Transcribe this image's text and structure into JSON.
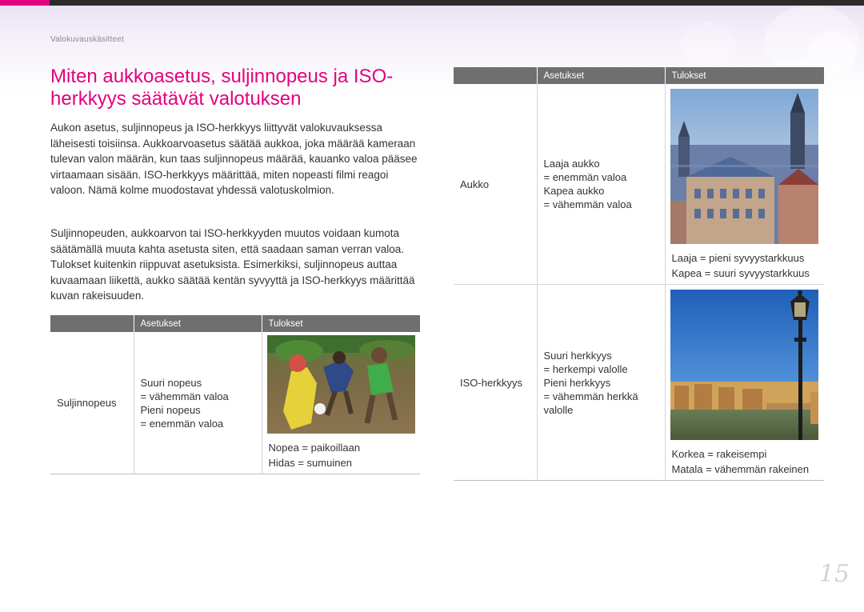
{
  "header": {
    "section_label": "Valokuvauskäsitteet"
  },
  "title": "Miten aukkoasetus, suljinnopeus ja ISO-herkkyys säätävät valotuksen",
  "paragraphs": [
    "Aukon asetus, suljinnopeus ja ISO-herkkyys liittyvät valokuvauksessa läheisesti toisiinsa. Aukkoarvoasetus säätää aukkoa, joka määrää kameraan tulevan valon määrän, kun taas suljinnopeus määrää, kauanko valoa pääsee virtaamaan sisään. ISO-herkkyys määrittää, miten nopeasti filmi reagoi valoon. Nämä kolme muodostavat yhdessä valotuskolmion.",
    "Suljinnopeuden, aukkoarvon tai ISO-herkkyyden muutos voidaan kumota säätämällä muuta kahta asetusta siten, että saadaan saman verran valoa. Tulokset kuitenkin riippuvat asetuksista. Esimerkiksi, suljinnopeus auttaa kuvaamaan liikettä, aukko säätää kentän syvyyttä ja ISO-herkkyys määrittää kuvan rakeisuuden."
  ],
  "table_left": {
    "headers": [
      "",
      "Asetukset",
      "Tulokset"
    ],
    "rows": [
      {
        "name": "Suljinnopeus",
        "settings": [
          "Suuri nopeus",
          "= vähemmän valoa",
          "Pieni nopeus",
          "= enemmän valoa"
        ],
        "photo": "children-playing-football-photo",
        "results": [
          "Nopea = paikoillaan",
          "Hidas = sumuinen"
        ]
      }
    ]
  },
  "table_right": {
    "headers": [
      "",
      "Asetukset",
      "Tulokset"
    ],
    "rows": [
      {
        "name": "Aukko",
        "settings": [
          "Laaja aukko",
          "= enemmän valoa",
          "Kapea aukko",
          "= vähemmän valoa"
        ],
        "photo": "city-rooftops-photo",
        "results": [
          "Laaja = pieni syvyystarkkuus",
          "Kapea = suuri syvyystarkkuus"
        ]
      },
      {
        "name": "ISO-herkkyys",
        "settings": [
          "Suuri herkkyys",
          "= herkempi valolle",
          "Pieni herkkyys",
          "= vähemmän herkkä valolle"
        ],
        "photo": "street-lamp-river-photo",
        "results": [
          "Korkea = rakeisempi",
          "Matala = vähemmän rakeinen"
        ]
      }
    ]
  },
  "page_number": "15",
  "colors": {
    "accent": "#e4007f",
    "table_header": "#6f6f6f",
    "top_bar": "#2b2b2b"
  }
}
